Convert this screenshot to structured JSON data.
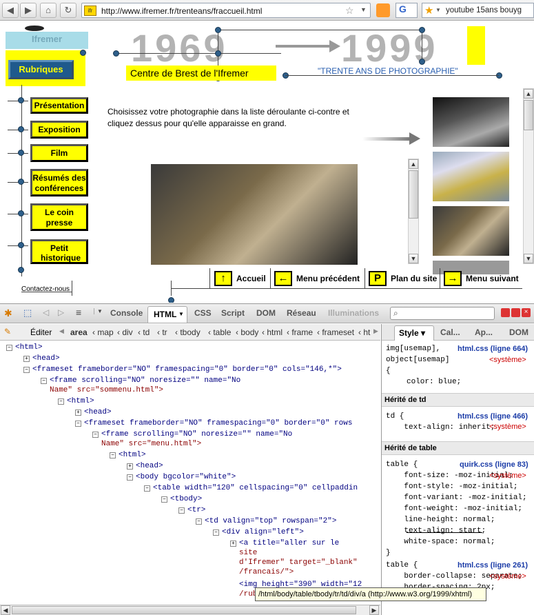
{
  "browser": {
    "url": "http://www.ifremer.fr/trenteans/fraccueil.html",
    "search_text": "youtube 15ans bouyg",
    "search_engine_label": "G"
  },
  "page": {
    "logo_text": "Ifremer",
    "years_left": "1969",
    "years_right": "1999",
    "centre_title": "Centre de Brest de l'Ifremer",
    "subtitle": "\"TRENTE ANS DE PHOTOGRAPHIE\"",
    "instructions": "Choisissez votre photographie dans la liste déroulante ci-contre et cliquez dessus pour qu'elle apparaisse en grand.",
    "rubriques": "Rubriques",
    "menu": [
      {
        "label": "Présentation"
      },
      {
        "label": "Exposition"
      },
      {
        "label": "Film"
      },
      {
        "label": "Résumés des conférences"
      },
      {
        "label": "Le coin presse"
      },
      {
        "label": "Petit historique"
      }
    ],
    "contact": "Contactez-nous",
    "nav": [
      {
        "label": "Accueil",
        "icon": "↑"
      },
      {
        "label": "Menu précédent",
        "icon": "←"
      },
      {
        "label": "Plan du site",
        "icon": "P"
      },
      {
        "label": "Menu suivant",
        "icon": "→"
      }
    ]
  },
  "firebug": {
    "tabs": [
      "Console",
      "HTML",
      "CSS",
      "Script",
      "DOM",
      "Réseau",
      "Illuminations"
    ],
    "edit_label": "Éditer",
    "breadcrumbs": [
      "area",
      "map",
      "div",
      "td",
      "tr",
      "tbody",
      "table",
      "body",
      "html",
      "frame",
      "frameset",
      "ht"
    ],
    "side_tabs": [
      "Style",
      "Cal...",
      "Ap...",
      "DOM"
    ],
    "tooltip": "/html/body/table/tbody/tr/td/div/a (http://www.w3.org/1999/xhtml)",
    "tree": [
      "<html>",
      "<head>",
      "<frameset frameborder=\"NO\" framespacing=\"0\" border=\"0\" cols=\"146,*\">",
      "<frame scrolling=\"NO\" noresize=\"\" name=\"No",
      "Name\" src=\"sommenu.html\">",
      "<html>",
      "<head>",
      "<frameset frameborder=\"NO\" framespacing=\"0\" border=\"0\" rows",
      "<frame scrolling=\"NO\" noresize=\"\" name=\"No",
      "Name\" src=\"menu.html\">",
      "<html>",
      "<head>",
      "<body bgcolor=\"white\">",
      "<table width=\"120\" cellspacing=\"0\" cellpaddin",
      "<tbody>",
      "<tr>",
      "<td valign=\"top\" rowspan=\"2\">",
      "<div align=\"left\">",
      "<a title=\"aller sur le",
      "site",
      "d'Ifremer\" target=\"_blank\"",
      "/francais/\">",
      "<img height=\"390\" width=\"12",
      "/rub"
    ],
    "styles": {
      "rule1_selector": "img[usemap],\nobject[usemap]\n{",
      "rule1_body": "color: blue;",
      "rule1_src": "html.css (ligne 664)",
      "system": "<système>",
      "herit_td": "Hérité de td",
      "td_rule": "td {\n    text-align: inherit;",
      "td_src": "html.css (ligne 466)",
      "herit_table": "Hérité de table",
      "table_rule": "table {\n    font-size: -moz-initial;\n    font-style: -moz-initial;\n    font-variant: -moz-initial;\n    font-weight: -moz-initial;\n    line-height: normal;\n    text-align: start;\n    white-space: normal;\n}",
      "table_src": "quirk.css (ligne 83)",
      "table2_rule": "table {\n    border-collapse: separate;\n    border-spacing: 2px;",
      "table2_src": "html.css (ligne 261)"
    }
  }
}
